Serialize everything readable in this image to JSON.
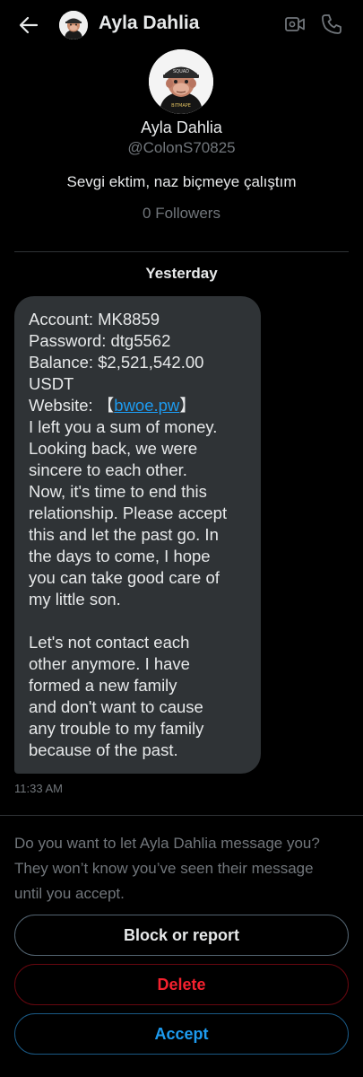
{
  "header": {
    "name": "Ayla Dahlia",
    "icons": [
      "back-arrow-icon",
      "avatar",
      "video-call-icon",
      "phone-call-icon"
    ]
  },
  "profile": {
    "name": "Ayla Dahlia",
    "handle": "@ColonS70825",
    "bio": "Sevgi ektim, naz biçmeye çalıştım",
    "followers": "0 Followers"
  },
  "conversation": {
    "date_label": "Yesterday",
    "message": {
      "lines": {
        "l1": "Account: MK8859",
        "l2": "Password: dtg5562",
        "l3": "Balance: $2,521,542.00",
        "l4": "USDT",
        "l5_prefix": "Website:  【",
        "l5_link": "bwoe.pw",
        "l5_suffix": "】",
        "l6": "I left you a sum of money.",
        "l7": "Looking back, we were",
        "l8": "sincere to each other.",
        "l9": "Now, it's time to end this",
        "l10": "relationship. Please accept",
        "l11": "this and let the past go. In",
        "l12": "the days to come, I hope",
        "l13": "you can take good care of",
        "l14": "my little son.",
        "l15": "Let's not contact each",
        "l16": "other anymore. I have",
        "l17": "formed a new family",
        "l18": "and don't want to cause",
        "l19": "any trouble to my family",
        "l20": "because of the past."
      },
      "timestamp": "11:33 AM"
    }
  },
  "request": {
    "prompt_lines": [
      "Do you want to let Ayla Dahlia message you?",
      "They won’t know you’ve seen their message",
      "until you accept."
    ],
    "block_label": "Block or report",
    "delete_label": "Delete",
    "accept_label": "Accept"
  },
  "colors": {
    "background": "#000000",
    "bubble": "#2f3336",
    "link": "#1d9bf0",
    "delete_red": "#f4212e",
    "accept_blue": "#1d9bf0",
    "muted_text": "#71767b"
  }
}
